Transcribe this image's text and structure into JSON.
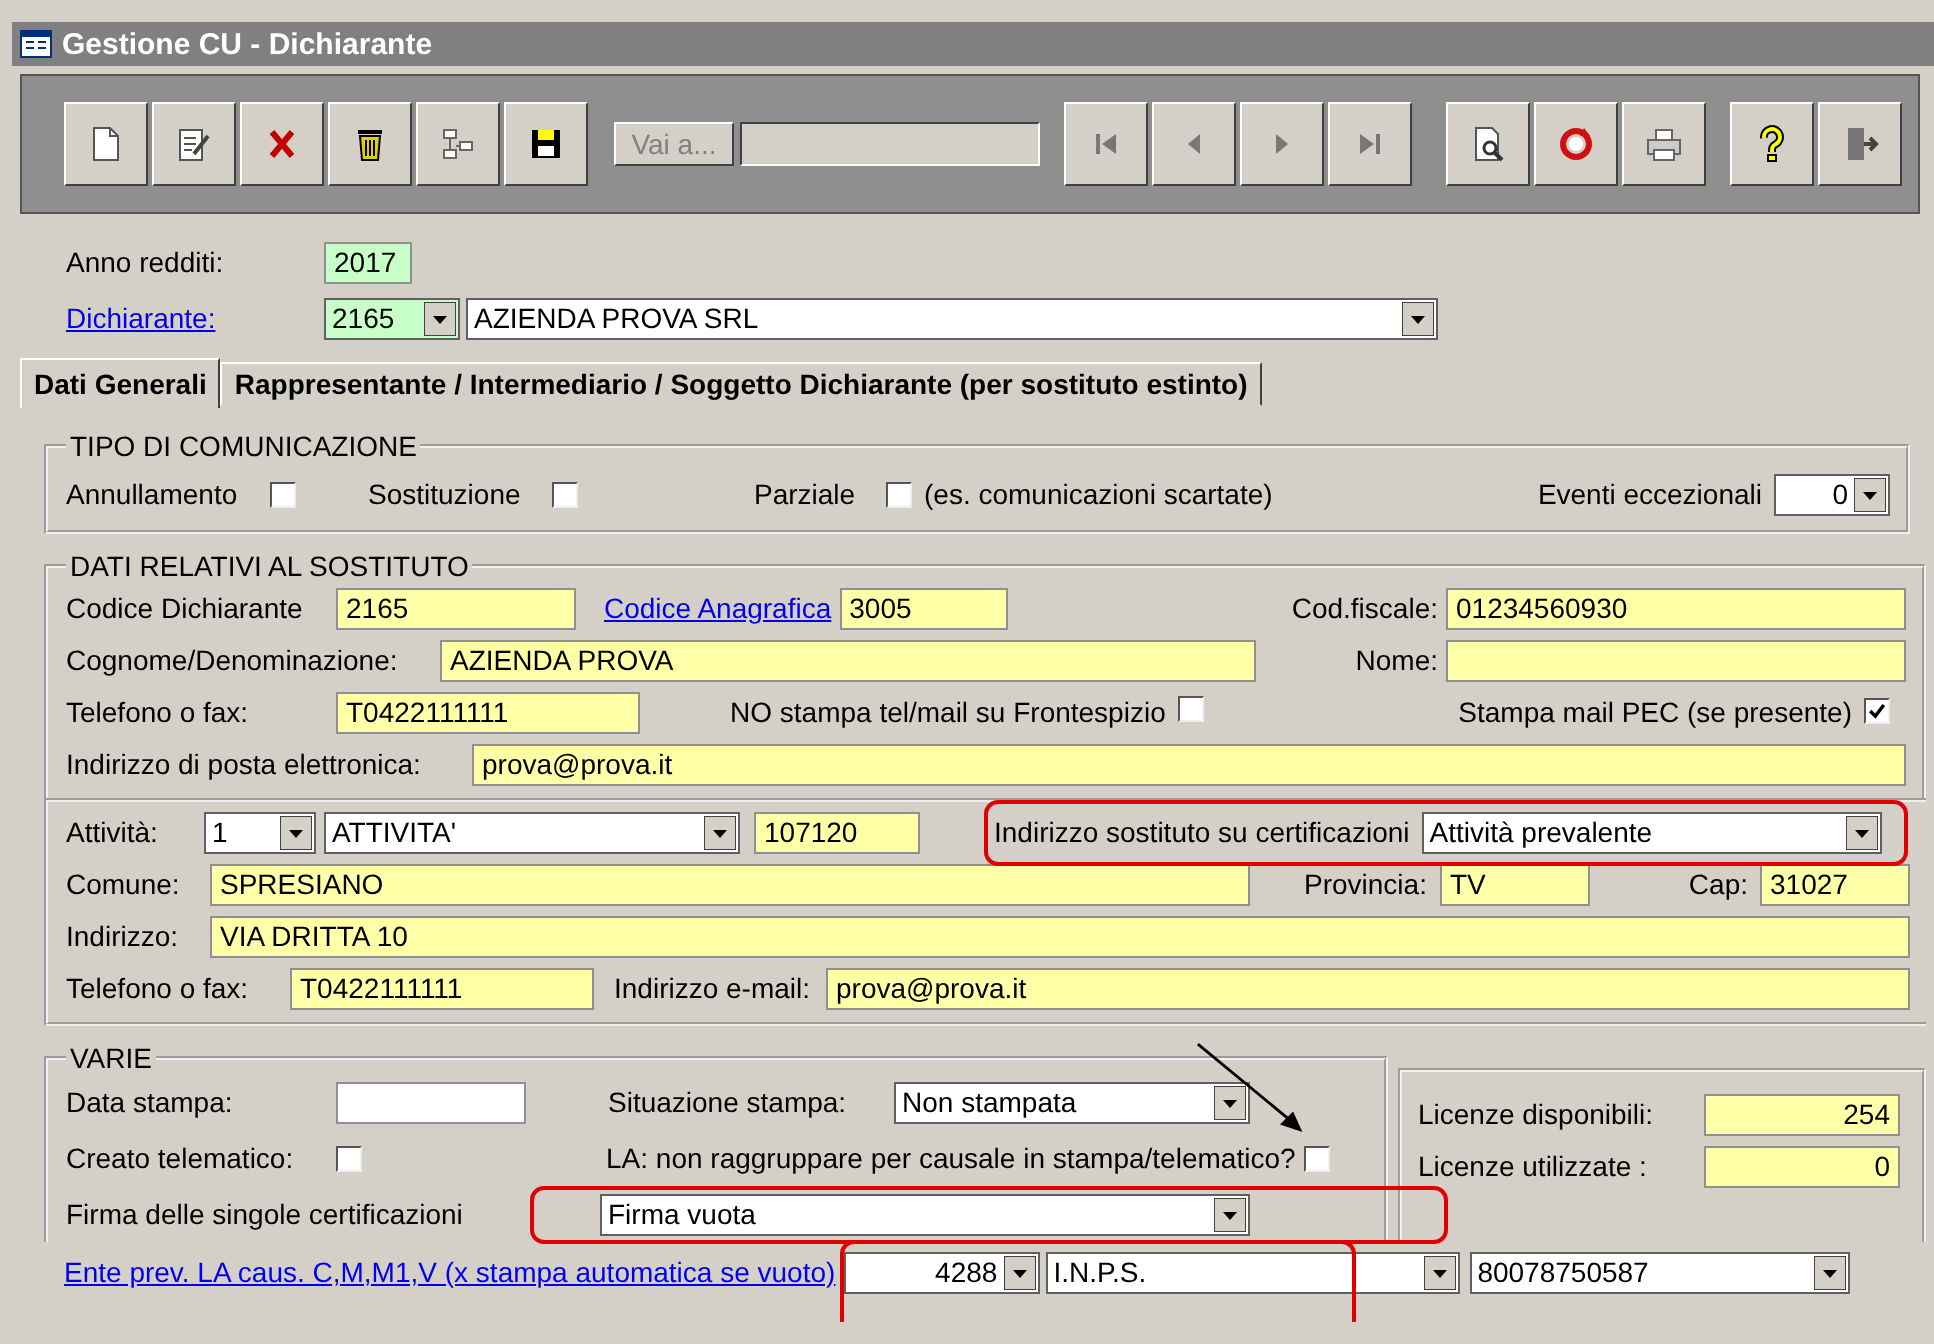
{
  "window": {
    "title": "Gestione CU - Dichiarante"
  },
  "toolbar": {
    "goto_button": "Vai a..."
  },
  "header": {
    "anno_label": "Anno redditi:",
    "anno_value": "2017",
    "dichiarante_link": "Dichiarante:",
    "dichiarante_code": "2165",
    "dichiarante_name": "AZIENDA PROVA SRL"
  },
  "tabs": [
    {
      "label": "Dati Generali",
      "selected": true
    },
    {
      "label": "Rappresentante / Intermediario / Soggetto Dichiarante (per sostituto estinto)",
      "selected": false
    }
  ],
  "tipo_comunicazione": {
    "title": "TIPO DI COMUNICAZIONE",
    "checks": [
      {
        "label": "Annullamento",
        "checked": false
      },
      {
        "label": "Sostituzione",
        "checked": false
      },
      {
        "label": "Parziale",
        "checked": false
      }
    ],
    "note": "(es. comunicazioni scartate)",
    "eventi_label": "Eventi eccezionali",
    "eventi_value": "0"
  },
  "sostituto": {
    "title": "DATI RELATIVI AL SOSTITUTO",
    "codice_label": "Codice Dichiarante",
    "codice": "2165",
    "anagrafica_link": "Codice Anagrafica",
    "anagrafica": "3005",
    "cf_label": "Cod.fiscale:",
    "cf": "01234560930",
    "denominazione_label": "Cognome/Denominazione:",
    "denominazione": "AZIENDA PROVA",
    "nome_label": "Nome:",
    "telefono_label": "Telefono o fax:",
    "telefono": "T0422111111",
    "no_stampa": {
      "label": "NO stampa tel/mail su Frontespizio",
      "checked": false
    },
    "stampa_pec": {
      "label": "Stampa mail PEC (se presente)",
      "checked": true
    },
    "email_label": "Indirizzo di posta elettronica:",
    "email": "prova@prova.it"
  },
  "attivita": {
    "label": "Attività:",
    "number": "1",
    "name": "ATTIVITA'",
    "code": "107120",
    "indirizzo_cert_label": "Indirizzo sostituto su certificazioni",
    "indirizzo_cert": "Attività prevalente",
    "comune_label": "Comune:",
    "comune": "SPRESIANO",
    "provincia_label": "Provincia:",
    "provincia": "TV",
    "cap_label": "Cap:",
    "cap": "31027",
    "indirizzo_label": "Indirizzo:",
    "indirizzo": "VIA DRITTA 10",
    "telefono_label": "Telefono o fax:",
    "telefono": "T0422111111",
    "email_label": "Indirizzo e-mail:",
    "email": "prova@prova.it"
  },
  "varie": {
    "title": "VARIE",
    "data_stampa_label": "Data stampa:",
    "situazione_label": "Situazione stampa:",
    "situazione": "Non stampata",
    "creato": {
      "label": "Creato telematico:",
      "checked": false
    },
    "la_check": {
      "label": "LA: non raggruppare per causale in stampa/telematico?",
      "checked": false
    },
    "firma_label": "Firma delle singole certificazioni",
    "firma": "Firma vuota",
    "ente_link": "Ente prev. LA caus. C,M,M1,V (x stampa automatica se vuoto)",
    "ente_code": "4288",
    "ente_name": "I.N.P.S.",
    "ente_cf": "80078750587"
  },
  "licenze": [
    {
      "label": "Licenze disponibili:",
      "value": "254"
    },
    {
      "label": "Licenze utilizzate :",
      "value": "0"
    }
  ]
}
